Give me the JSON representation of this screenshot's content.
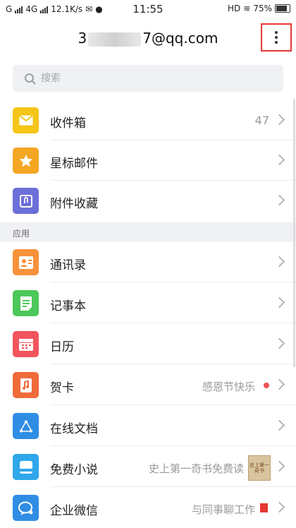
{
  "status": {
    "carrier": "G",
    "network": "4G",
    "speed": "12.1K/s",
    "time": "11:55",
    "hd": "HD",
    "battery": "75%"
  },
  "header": {
    "account_prefix": "3",
    "account_suffix": "7@qq.com",
    "menu_icon": "more-vert-icon"
  },
  "search": {
    "placeholder": "搜索"
  },
  "mail_items": [
    {
      "label": "收件箱",
      "count": "47",
      "icon": "inbox-icon",
      "color": "#f5c518"
    },
    {
      "label": "星标邮件",
      "icon": "star-icon",
      "color": "#f5a623"
    },
    {
      "label": "附件收藏",
      "icon": "attachment-icon",
      "color": "#6b6fd8"
    }
  ],
  "section_title": "应用",
  "apps": [
    {
      "label": "通讯录",
      "icon": "contacts-icon",
      "color": "#f7913a"
    },
    {
      "label": "记事本",
      "icon": "notes-icon",
      "color": "#4cc75a"
    },
    {
      "label": "日历",
      "icon": "calendar-icon",
      "color": "#f2555d"
    },
    {
      "label": "贺卡",
      "hint": "感恩节快乐",
      "icon": "card-icon",
      "color": "#f06a3a"
    },
    {
      "label": "在线文档",
      "icon": "docs-icon",
      "color": "#2f8de4"
    },
    {
      "label": "免费小说",
      "hint": "史上第一奇书免费读",
      "thumb": "史上第一奇书",
      "icon": "novel-icon",
      "color": "#2fa7ea"
    },
    {
      "label": "企业微信",
      "hint": "与同事聊工作",
      "icon": "wework-icon",
      "color": "#2f8de4"
    }
  ],
  "colors": {
    "accent_box": "#e53935",
    "divider": "#ececec"
  }
}
